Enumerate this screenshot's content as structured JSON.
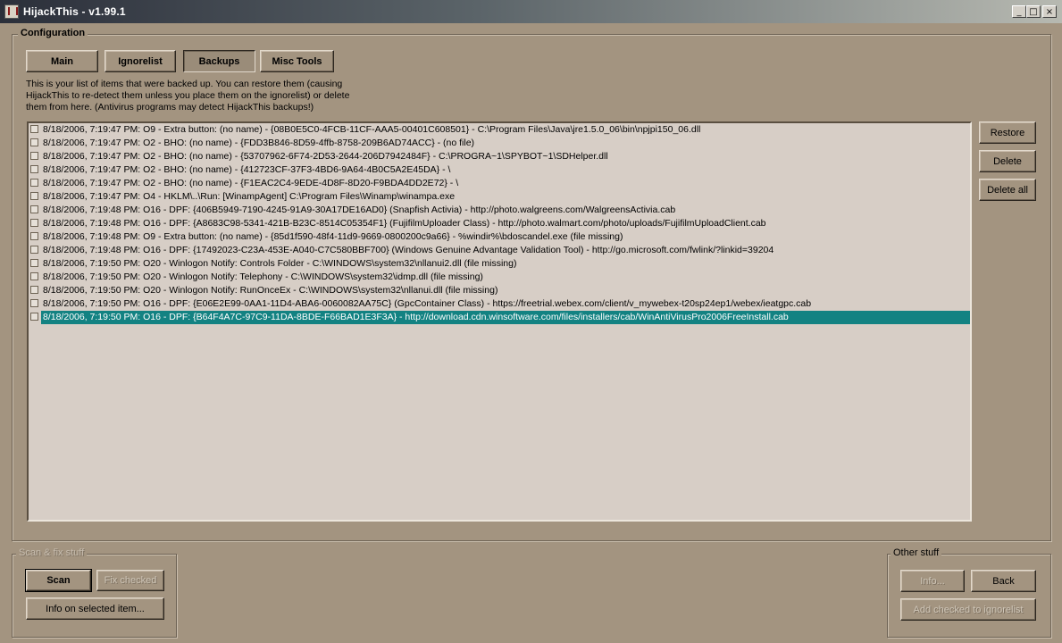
{
  "window": {
    "title": "HijackThis - v1.99.1",
    "controls": {
      "minimize": "_",
      "maximize": "□",
      "close": "×"
    }
  },
  "config": {
    "label": "Configuration",
    "tabs": [
      {
        "label": "Main"
      },
      {
        "label": "Ignorelist"
      },
      {
        "label": "Backups",
        "active": true
      },
      {
        "label": "Misc Tools"
      }
    ],
    "description": "This is your list of items that were backed up. You can restore them (causing HijackThis to re-detect them unless you place them on the ignorelist) or delete them from here. (Antivirus programs may detect HijackThis backups!)",
    "backups": [
      "8/18/2006, 7:19:47 PM: O9 - Extra button: (no name) - {08B0E5C0-4FCB-11CF-AAA5-00401C608501} - C:\\Program Files\\Java\\jre1.5.0_06\\bin\\npjpi150_06.dll",
      "8/18/2006, 7:19:47 PM: O2 - BHO: (no name) - {FDD3B846-8D59-4ffb-8758-209B6AD74ACC} - (no file)",
      "8/18/2006, 7:19:47 PM: O2 - BHO: (no name) - {53707962-6F74-2D53-2644-206D7942484F} - C:\\PROGRA~1\\SPYBOT~1\\SDHelper.dll",
      "8/18/2006, 7:19:47 PM: O2 - BHO: (no name) - {412723CF-37F3-4BD6-9A64-4B0C5A2E45DA} - \\",
      "8/18/2006, 7:19:47 PM: O2 - BHO: (no name) - {F1EAC2C4-9EDE-4D8F-8D20-F9BDA4DD2E72} - \\",
      "8/18/2006, 7:19:47 PM: O4 - HKLM\\..\\Run: [WinampAgent] C:\\Program Files\\Winamp\\winampa.exe",
      "8/18/2006, 7:19:48 PM: O16 - DPF: {406B5949-7190-4245-91A9-30A17DE16AD0} (Snapfish Activia) - http://photo.walgreens.com/WalgreensActivia.cab",
      "8/18/2006, 7:19:48 PM: O16 - DPF: {A8683C98-5341-421B-B23C-8514C05354F1} (FujifilmUploader Class) - http://photo.walmart.com/photo/uploads/FujifilmUploadClient.cab",
      "8/18/2006, 7:19:48 PM: O9 - Extra button: (no name) - {85d1f590-48f4-11d9-9669-0800200c9a66} - %windir%\\bdoscandel.exe (file missing)",
      "8/18/2006, 7:19:48 PM: O16 - DPF: {17492023-C23A-453E-A040-C7C580BBF700} (Windows Genuine Advantage Validation Tool) - http://go.microsoft.com/fwlink/?linkid=39204",
      "8/18/2006, 7:19:50 PM: O20 - Winlogon Notify: Controls Folder - C:\\WINDOWS\\system32\\nllanui2.dll (file missing)",
      "8/18/2006, 7:19:50 PM: O20 - Winlogon Notify: Telephony - C:\\WINDOWS\\system32\\idmp.dll (file missing)",
      "8/18/2006, 7:19:50 PM: O20 - Winlogon Notify: RunOnceEx - C:\\WINDOWS\\system32\\nllanui.dll (file missing)",
      "8/18/2006, 7:19:50 PM: O16 - DPF: {E06E2E99-0AA1-11D4-ABA6-0060082AA75C} (GpcContainer Class) - https://freetrial.webex.com/client/v_mywebex-t20sp24ep1/webex/ieatgpc.cab",
      "8/18/2006, 7:19:50 PM: O16 - DPF: {B64F4A7C-97C9-11DA-8BDE-F66BAD1E3F3A} - http://download.cdn.winsoftware.com/files/installers/cab/WinAntiVirusPro2006FreeInstall.cab"
    ],
    "selected_index": 14,
    "buttons": {
      "restore": "Restore",
      "delete": "Delete",
      "delete_all": "Delete all"
    }
  },
  "scan": {
    "label": "Scan & fix stuff",
    "scan": "Scan",
    "fix_checked": "Fix checked",
    "info_selected": "Info on selected item..."
  },
  "other": {
    "label": "Other stuff",
    "info": "Info...",
    "back": "Back",
    "add_checked": "Add checked to ignorelist"
  }
}
